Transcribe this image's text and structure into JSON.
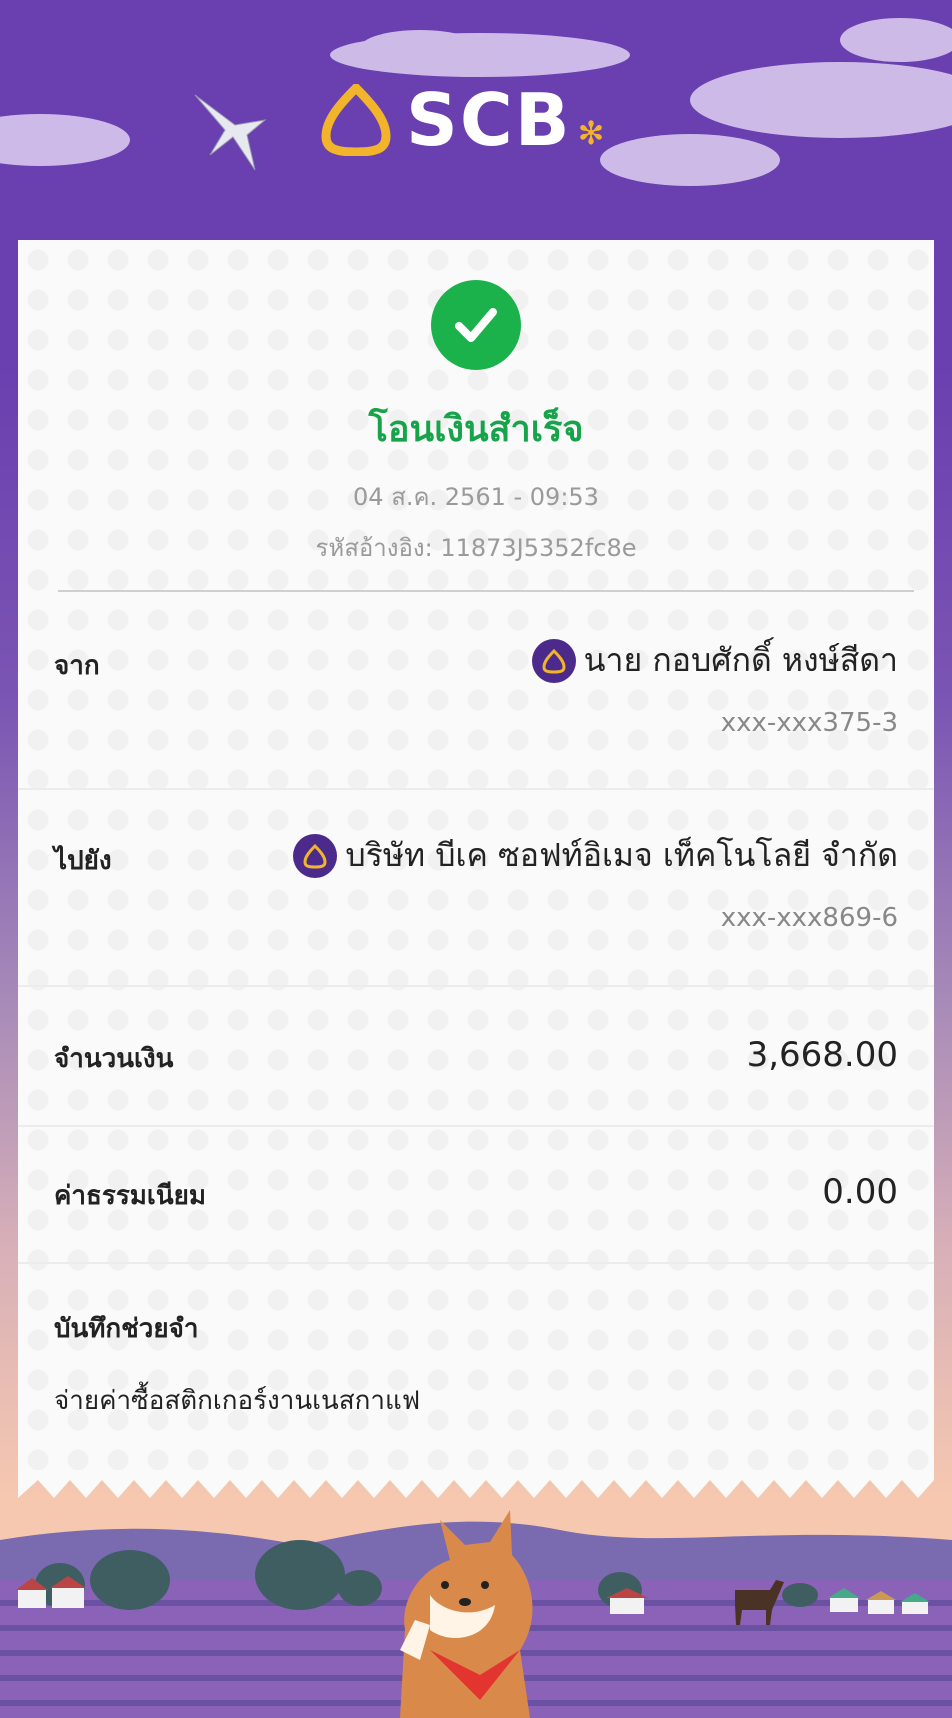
{
  "header": {
    "brand": "SCB"
  },
  "status": {
    "title": "โอนเงินสำเร็จ",
    "datetime": "04 ส.ค. 2561 - 09:53",
    "reference": "รหัสอ้างอิง: 11873J5352fc8e"
  },
  "from": {
    "label": "จาก",
    "name": "นาย กอบศักดิ์ หงษ์สีดา",
    "account": "xxx-xxx375-3"
  },
  "to": {
    "label": "ไปยัง",
    "name": "บริษัท บีเค ซอฟท์อิเมจ เท็คโนโลยี จำกัด",
    "account": "xxx-xxx869-6"
  },
  "amount": {
    "label": "จำนวนเงิน",
    "value": "3,668.00"
  },
  "fee": {
    "label": "ค่าธรรมเนียม",
    "value": "0.00"
  },
  "memo": {
    "label": "บันทึกช่วยจำ",
    "text": "จ่ายค่าซื้อสติกเกอร์งานเนสกาแฟ"
  },
  "colors": {
    "brand_purple": "#6a3fb0",
    "success_green": "#17a34a",
    "badge_purple": "#4b2a8b",
    "logo_gold": "#f2b42a"
  },
  "icons": [
    "bird-icon",
    "scb-logo-icon",
    "check-icon",
    "scb-badge-icon"
  ]
}
